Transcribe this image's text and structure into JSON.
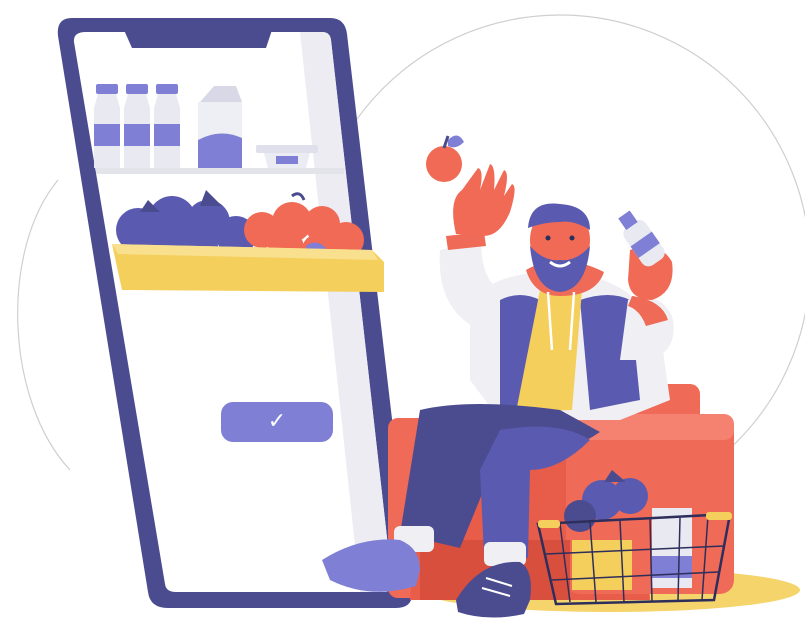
{
  "scene": {
    "description_free": true,
    "icons": {
      "checkmark": "checkmark-icon",
      "apple": "apple-icon",
      "milk_bottle": "milk-bottle-icon",
      "milk_carton": "milk-carton-icon",
      "yogurt": "yogurt-cup-icon",
      "basket": "basket-icon",
      "armchair": "armchair-icon"
    },
    "colors": {
      "phone_frame": "#4b4c8f",
      "screen": "#ffffff",
      "accent": "#7f7fd6",
      "apple": "#f06a55",
      "crate": "#f4cf5c",
      "chair": "#ef6a57",
      "outline_circle": "#c8c8c8"
    }
  },
  "phone": {
    "confirm_button": {
      "glyph": "✓"
    }
  }
}
